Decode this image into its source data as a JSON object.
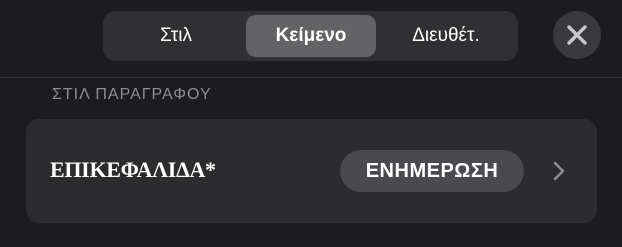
{
  "tabs": [
    {
      "label": "Στιλ",
      "selected": false
    },
    {
      "label": "Κείμενο",
      "selected": true
    },
    {
      "label": "Διευθέτ.",
      "selected": false
    }
  ],
  "icons": {
    "close": "close-icon",
    "chevron": "chevron-right-icon"
  },
  "section": {
    "header": "ΣΤΙΛ ΠΑΡΑΓΡΑΦΟΥ"
  },
  "paragraph_style": {
    "name": "ΕΠΙΚΕΦΑΛΙΔΑ*",
    "update_label": "ΕΝΗΜΕΡΩΣΗ"
  },
  "colors": {
    "background": "#1c1c1e",
    "selected_tab": "#636366",
    "row_background": "#2c2c2e"
  }
}
